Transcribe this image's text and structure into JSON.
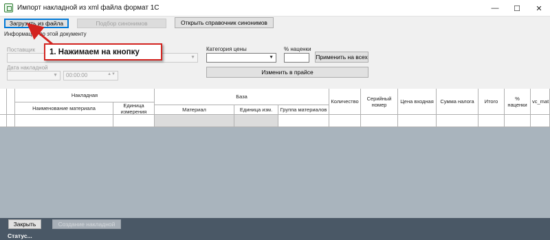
{
  "window": {
    "title": "Импорт накладной из xml файла формат 1С",
    "minimize_glyph": "—",
    "maximize_glyph": "☐",
    "close_glyph": "✕"
  },
  "toolbar": {
    "load_file_label": "Загрузить из файла",
    "synonym_pick_label": "Подбор синонимов",
    "open_synonyms_label": "Открыть справочник синонимов"
  },
  "doc_info": {
    "section_label": "Информация по этой документу",
    "supplier_label": "Поставщик",
    "supplier_value": "",
    "date_label": "Дата накладной",
    "date_value": "",
    "time_value": "00:00:00"
  },
  "pricing": {
    "price_category_label": "Категория цены",
    "price_category_value": "",
    "markup_label": "% наценки",
    "markup_value": "",
    "apply_all_label": "Применить на всех",
    "change_in_price_label": "Изменить в прайсе"
  },
  "table": {
    "group_invoice": "Накладная",
    "group_base": "База",
    "columns": {
      "material_name": "Наименование материала",
      "unit": "Единица измерения",
      "material": "Материал",
      "unit_short": "Единица изм.",
      "material_group": "Группа материалов",
      "quantity": "Количество",
      "serial": "Серийный номер",
      "price_in": "Цена входная",
      "tax_sum": "Сумма налога",
      "total": "Итого",
      "markup": "% наценки",
      "vc_mat": "vc_mat"
    }
  },
  "footer": {
    "close_label": "Закрыть",
    "create_invoice_label": "Создание накладной",
    "status_text": "Статус..."
  },
  "annotation": {
    "text": "1. Нажимаем на кнопку",
    "color": "#d3231f"
  },
  "colors": {
    "accent": "#0078d7",
    "grid_background": "#a9b4bd",
    "footer_background": "#4a5866"
  }
}
